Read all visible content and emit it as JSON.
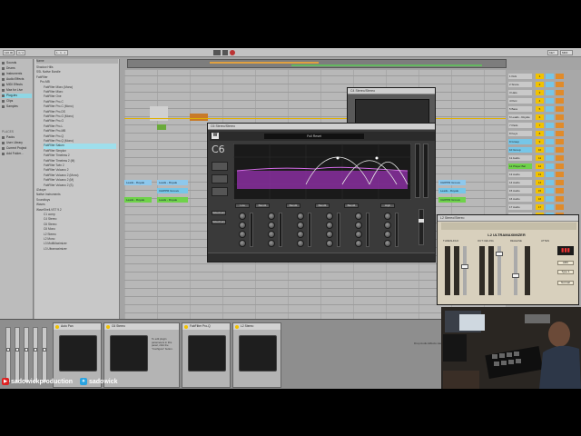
{
  "transport": {
    "tempo": "120.00",
    "signature": "4 / 4",
    "position": "1 . 1 . 1",
    "key_label": "KEY",
    "midi_label": "MIDI"
  },
  "browser": {
    "categories": [
      {
        "label": "Sounds"
      },
      {
        "label": "Drums"
      },
      {
        "label": "Instruments"
      },
      {
        "label": "Audio Effects"
      },
      {
        "label": "MIDI Effects"
      },
      {
        "label": "Max for Live"
      },
      {
        "label": "Plug-ins"
      },
      {
        "label": "Clips"
      },
      {
        "label": "Samples"
      }
    ],
    "places_header": "PLACES",
    "places": [
      {
        "label": "Packs"
      },
      {
        "label": "User Library"
      },
      {
        "label": "Current Project"
      },
      {
        "label": "Add Folder..."
      }
    ],
    "header": "Name",
    "files": [
      {
        "label": "Shadow Hills"
      },
      {
        "label": "SSL Native Bundle"
      },
      {
        "label": "FabFilter"
      },
      {
        "label": "Pro-MB"
      },
      {
        "label": "FabFilter Micro (Mono)"
      },
      {
        "label": "FabFilter Micro"
      },
      {
        "label": "FabFilter One"
      },
      {
        "label": "FabFilter Pro-C"
      },
      {
        "label": "FabFilter Pro-C (Mono)"
      },
      {
        "label": "FabFilter Pro-DS"
      },
      {
        "label": "FabFilter Pro-G (Mono)"
      },
      {
        "label": "FabFilter Pro-G"
      },
      {
        "label": "FabFilter Pro-L"
      },
      {
        "label": "FabFilter Pro-MB"
      },
      {
        "label": "FabFilter Pro-Q"
      },
      {
        "label": "FabFilter Pro-Q (Mono)"
      },
      {
        "label": "FabFilter Saturn"
      },
      {
        "label": "FabFilter Simplon"
      },
      {
        "label": "FabFilter Timeless 2"
      },
      {
        "label": "FabFilter Timeless 2 (M)"
      },
      {
        "label": "FabFilter Twin 2"
      },
      {
        "label": "FabFilter Volcano 2"
      },
      {
        "label": "FabFilter Volcano 2 (Mono)"
      },
      {
        "label": "FabFilter Volcano 2 (M)"
      },
      {
        "label": "FabFilter Volcano 2 (S)"
      },
      {
        "label": "iZotope"
      },
      {
        "label": "Native Instruments"
      },
      {
        "label": "Soundtoys"
      },
      {
        "label": "Waves"
      },
      {
        "label": "WaveShell-VST 9.2"
      },
      {
        "label": "C1 comp"
      },
      {
        "label": "C4 Stereo"
      },
      {
        "label": "C6 Stereo"
      },
      {
        "label": "C6 Mono"
      },
      {
        "label": "L2 Stereo"
      },
      {
        "label": "L2 Mono"
      },
      {
        "label": "L3 MultiMaximizer"
      },
      {
        "label": "L3 Ultramaximizer"
      }
    ]
  },
  "arrange": {
    "clips": [
      {
        "label": "Leads - Royale"
      },
      {
        "label": "Leads - Royale"
      },
      {
        "label": "CHIPPR Groove"
      },
      {
        "label": "Leads - Royale"
      },
      {
        "label": "Leads - Royale"
      },
      {
        "label": "CHIPPR Groove"
      },
      {
        "label": "Leads - Royale"
      },
      {
        "label": "CHIPPR Groove"
      }
    ]
  },
  "mixer": {
    "tracks": [
      {
        "label": "1 Kick",
        "n": "1"
      },
      {
        "label": "2 Snare",
        "n": "2"
      },
      {
        "label": "3 Hats",
        "n": "3"
      },
      {
        "label": "4 Perc",
        "n": "4"
      },
      {
        "label": "5 Bass",
        "n": "5"
      },
      {
        "label": "6 Leads - Royale",
        "n": "6"
      },
      {
        "label": "7 Pads",
        "n": "7"
      },
      {
        "label": "8 Keys",
        "n": "8"
      },
      {
        "label": "9 Group",
        "n": "9"
      },
      {
        "label": "10 Group",
        "n": "10"
      },
      {
        "label": "11 Audio",
        "n": "11"
      },
      {
        "label": "12 Player Bal",
        "n": "12"
      },
      {
        "label": "13 Audio",
        "n": "13"
      },
      {
        "label": "14 Audio",
        "n": "14"
      },
      {
        "label": "15 Audio",
        "n": "15"
      },
      {
        "label": "16 Audio",
        "n": "16"
      },
      {
        "label": "17 Audio",
        "n": "17"
      },
      {
        "label": "18 Audio",
        "n": "18"
      },
      {
        "label": "19 Audio",
        "n": "19"
      },
      {
        "label": "20 Audio",
        "n": "20"
      }
    ]
  },
  "plugins": {
    "c6_title": "C6 Stereo/Stereo",
    "c6_preset": "Full Reset",
    "c6_logo": "C6",
    "c6_bands": [
      "Low",
      "Band1",
      "Band2",
      "Band3",
      "Band4",
      "High",
      "Sidechain1",
      "Sidechain2"
    ],
    "other_title": "C4 Stereo/Stereo",
    "l2_title": "L2 Stereo/Stereo",
    "l2_name": "L2 ULTRAMAXIMIZER",
    "l2_labels": [
      "THRESHOLD",
      "OUT CEILING",
      "RELEASE",
      "ATTEN"
    ],
    "l2_buttons": [
      "ARC",
      "Type 1",
      "Normal"
    ]
  },
  "devices": [
    {
      "title": "Auto Pan",
      "info": ""
    },
    {
      "title": "C6 Stereo",
      "info": "To edit plugin parameters in this panel, click the \"Configure\" button."
    },
    {
      "title": "FabFilter Pro-Q",
      "info": ""
    },
    {
      "title": "L2 Stereo",
      "info": ""
    }
  ],
  "status": {
    "bottom_right": "Drop Audio Effects Here"
  },
  "social": {
    "youtube": "sadowickproduction",
    "twitter": "sadowick"
  },
  "colors": {
    "accent_green": "#6fd24a",
    "accent_blue": "#76c6e8",
    "accent_orange": "#e08b2a",
    "eq_purple": "#8a2fa0",
    "yellow_meter": "#f2c200"
  }
}
